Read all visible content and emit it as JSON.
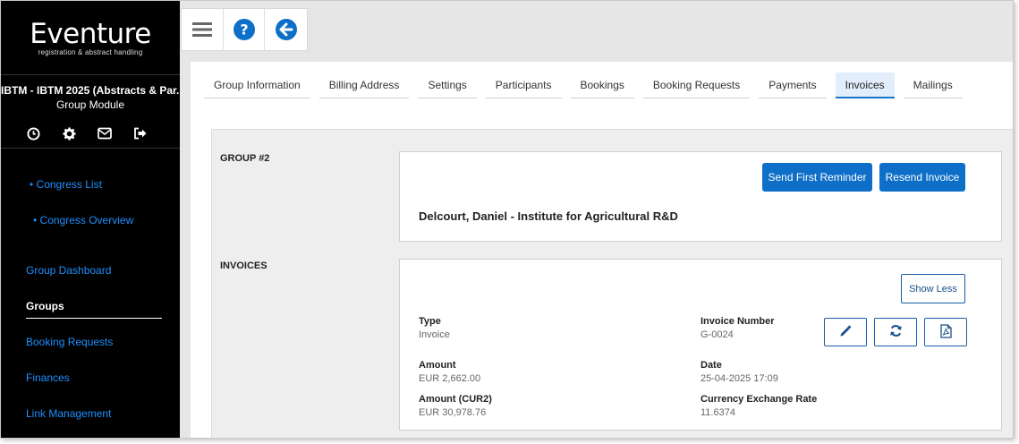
{
  "sidebar": {
    "logo_main": "Eventure",
    "logo_sub": "registration & abstract handling",
    "congress_title": "IBTM - IBTM 2025 (Abstracts & Par...",
    "module_name": "Group Module",
    "icons": [
      "clock-icon",
      "gear-icon",
      "envelope-icon",
      "logout-icon"
    ],
    "congress_list": "• Congress List",
    "congress_overview": "• Congress Overview",
    "nav": {
      "group_dashboard": "Group Dashboard",
      "groups": "Groups",
      "booking_requests": "Booking Requests",
      "finances": "Finances",
      "link_management": "Link Management"
    }
  },
  "toolbar": {
    "icons": [
      "menu-icon",
      "help-icon",
      "back-arrow-icon"
    ]
  },
  "tabs": [
    {
      "label": "Group Information"
    },
    {
      "label": "Billing Address"
    },
    {
      "label": "Settings"
    },
    {
      "label": "Participants"
    },
    {
      "label": "Bookings"
    },
    {
      "label": "Booking Requests"
    },
    {
      "label": "Payments"
    },
    {
      "label": "Invoices",
      "active": true
    },
    {
      "label": "Mailings"
    }
  ],
  "group": {
    "section_label": "GROUP #2",
    "send_first_reminder": "Send First Reminder",
    "resend_invoice": "Resend Invoice",
    "person": "Delcourt, Daniel - Institute for Agricultural R&D"
  },
  "invoices": {
    "section_label": "INVOICES",
    "show_less": "Show Less",
    "type_label": "Type",
    "type_value": "Invoice",
    "invoice_number_label": "Invoice Number",
    "invoice_number_value": "G-0024",
    "amount_label": "Amount",
    "amount_value": "EUR 2,662.00",
    "date_label": "Date",
    "date_value": "25-04-2025 17:09",
    "amount_cur2_label": "Amount (CUR2)",
    "amount_cur2_value": "EUR 30,978.76",
    "exchange_rate_label": "Currency Exchange Rate",
    "exchange_rate_value": "11.6374",
    "action_icons": [
      "pencil-icon",
      "refresh-icon",
      "pdf-icon"
    ]
  },
  "colors": {
    "primary": "#0e6fc8",
    "sidebar_bg": "#000000",
    "link": "#1e90ff",
    "active_tab_bg": "#e3eefc"
  }
}
